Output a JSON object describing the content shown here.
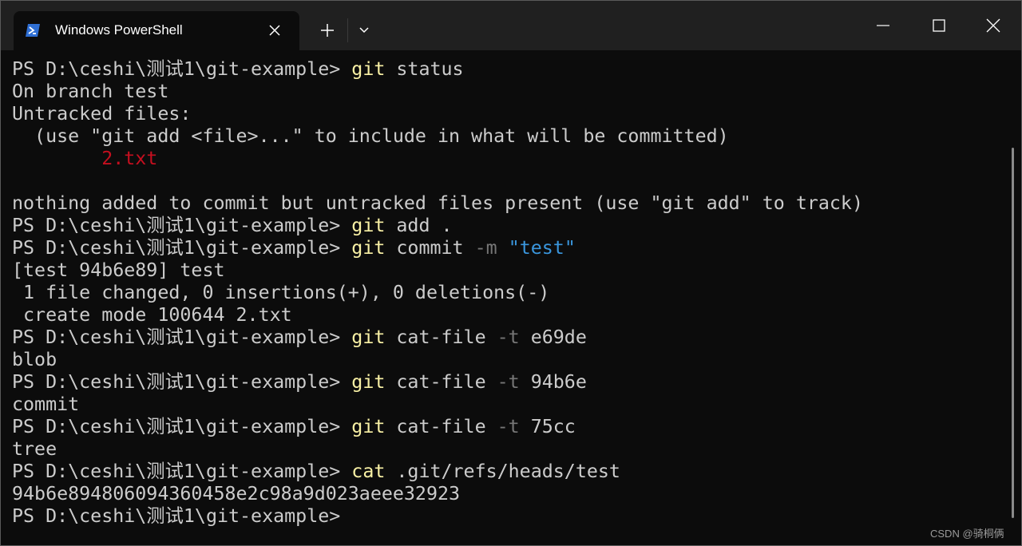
{
  "window": {
    "tab_title": "Windows PowerShell",
    "colors": {
      "titlebar": "#202020",
      "console_bg": "#0c0c0c",
      "text": "#cccccc",
      "command": "#f9f1a5",
      "parameter": "#767676",
      "string": "#3a96dd",
      "error_red": "#c50f1f"
    },
    "icons": {
      "tab": "powershell-icon",
      "close_tab": "close-icon",
      "new_tab": "plus-icon",
      "dropdown": "chevron-down-icon",
      "minimize": "minimize-icon",
      "maximize": "maximize-icon",
      "close_window": "close-icon"
    }
  },
  "console": {
    "lines": [
      [
        {
          "t": "PS D:\\ceshi\\测试1\\git-example> "
        },
        {
          "t": "git",
          "c": "cmd"
        },
        {
          "t": " status"
        }
      ],
      [
        {
          "t": "On branch test"
        }
      ],
      [
        {
          "t": "Untracked files:"
        }
      ],
      [
        {
          "t": "  (use \"git add <file>...\" to include in what will be committed)"
        }
      ],
      [
        {
          "t": "        "
        },
        {
          "t": "2.txt",
          "c": "red"
        }
      ],
      [
        {
          "t": ""
        }
      ],
      [
        {
          "t": "nothing added to commit but untracked files present (use \"git add\" to track)"
        }
      ],
      [
        {
          "t": "PS D:\\ceshi\\测试1\\git-example> "
        },
        {
          "t": "git",
          "c": "cmd"
        },
        {
          "t": " add ."
        }
      ],
      [
        {
          "t": "PS D:\\ceshi\\测试1\\git-example> "
        },
        {
          "t": "git",
          "c": "cmd"
        },
        {
          "t": " commit "
        },
        {
          "t": "-m",
          "c": "param"
        },
        {
          "t": " "
        },
        {
          "t": "\"test\"",
          "c": "str"
        }
      ],
      [
        {
          "t": "[test 94b6e89] test"
        }
      ],
      [
        {
          "t": " 1 file changed, 0 insertions(+), 0 deletions(-)"
        }
      ],
      [
        {
          "t": " create mode 100644 2.txt"
        }
      ],
      [
        {
          "t": "PS D:\\ceshi\\测试1\\git-example> "
        },
        {
          "t": "git",
          "c": "cmd"
        },
        {
          "t": " cat-file "
        },
        {
          "t": "-t",
          "c": "param"
        },
        {
          "t": " e69de"
        }
      ],
      [
        {
          "t": "blob"
        }
      ],
      [
        {
          "t": "PS D:\\ceshi\\测试1\\git-example> "
        },
        {
          "t": "git",
          "c": "cmd"
        },
        {
          "t": " cat-file "
        },
        {
          "t": "-t",
          "c": "param"
        },
        {
          "t": " 94b6e"
        }
      ],
      [
        {
          "t": "commit"
        }
      ],
      [
        {
          "t": "PS D:\\ceshi\\测试1\\git-example> "
        },
        {
          "t": "git",
          "c": "cmd"
        },
        {
          "t": " cat-file "
        },
        {
          "t": "-t",
          "c": "param"
        },
        {
          "t": " 75cc"
        }
      ],
      [
        {
          "t": "tree"
        }
      ],
      [
        {
          "t": "PS D:\\ceshi\\测试1\\git-example> "
        },
        {
          "t": "cat",
          "c": "cmd"
        },
        {
          "t": " .git/refs/heads/test"
        }
      ],
      [
        {
          "t": "94b6e894806094360458e2c98a9d023aeee32923"
        }
      ],
      [
        {
          "t": "PS D:\\ceshi\\测试1\\git-example> "
        }
      ]
    ]
  },
  "watermark": "CSDN @骑桐俩"
}
